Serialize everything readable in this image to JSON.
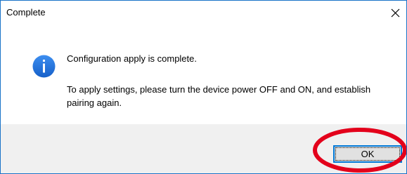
{
  "window": {
    "title": "Complete",
    "close_symbol": "✕"
  },
  "message": {
    "icon": "info-icon",
    "line1": "Configuration apply is complete.",
    "line2": "To apply settings, please turn the device power OFF and ON, and establish pairing again."
  },
  "buttons": {
    "ok_label": "OK"
  },
  "colors": {
    "accent": "#0078d7",
    "info_icon": "#1e6fd9",
    "highlight": "#e3001b",
    "footer_bg": "#f0f0f0"
  }
}
